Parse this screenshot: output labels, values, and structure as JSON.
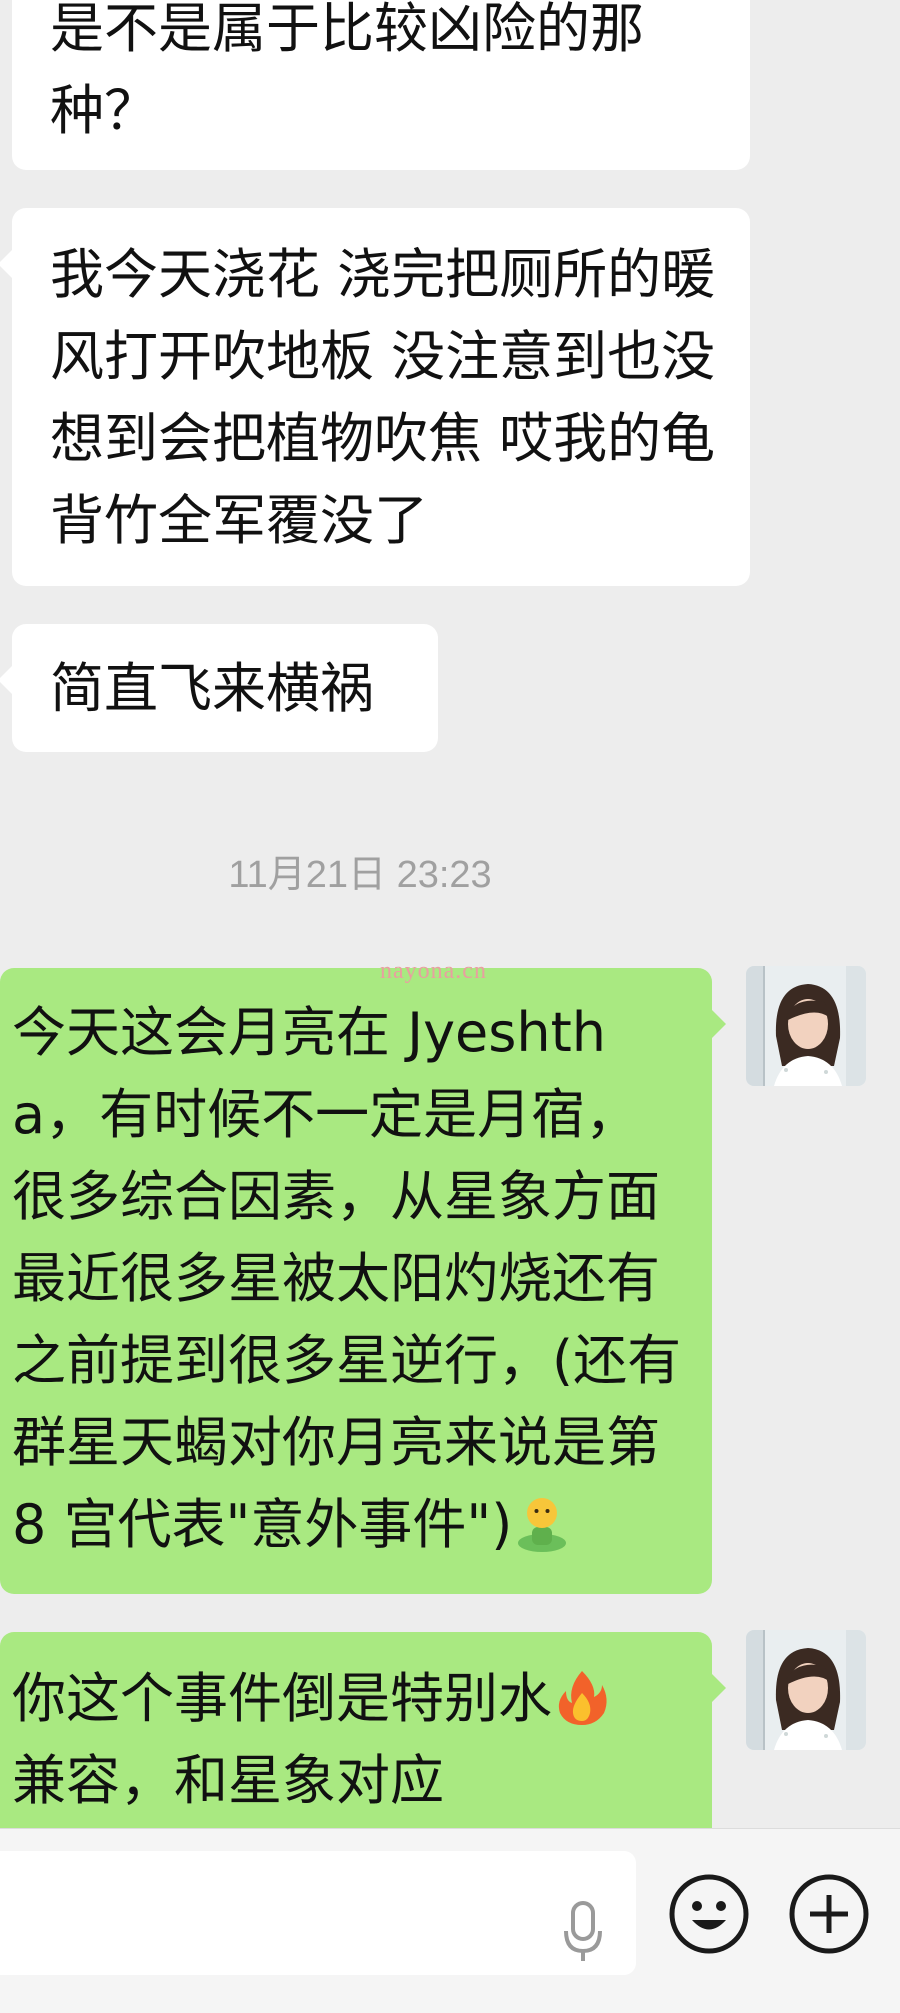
{
  "messages": {
    "in_1": "是不是属于比较凶险的那种？",
    "in_2": "我今天浇花 浇完把厕所的暖风打开吹地板 没注意到也没想到会把植物吹焦 哎我的龟背竹全军覆没了",
    "in_3": "简直飞来横祸",
    "timestamp": "11月21日 23:23",
    "out_1": "今天这会月亮在 Jyeshtha，有时候不一定是月宿，很多综合因素，从星象方面最近很多星被太阳灼烧还有之前提到很多星逆行，(还有群星天蝎对你月亮来说是第 8 宫代表\"意外事件\")",
    "out_2": "你这个事件倒是特别水",
    "out_2_tail": "兼容，和星象对应"
  },
  "watermark": "nayona.cn",
  "icons": {
    "inline_emoji_1": "standing-person-emoji",
    "inline_emoji_2": "fire-emoji",
    "mic": "microphone-icon",
    "emoji_button": "smiley-face-icon",
    "plus_button": "plus-circle-icon"
  },
  "colors": {
    "outgoing_bubble": "#a9e981",
    "incoming_bubble": "#ffffff",
    "background": "#ededed"
  }
}
